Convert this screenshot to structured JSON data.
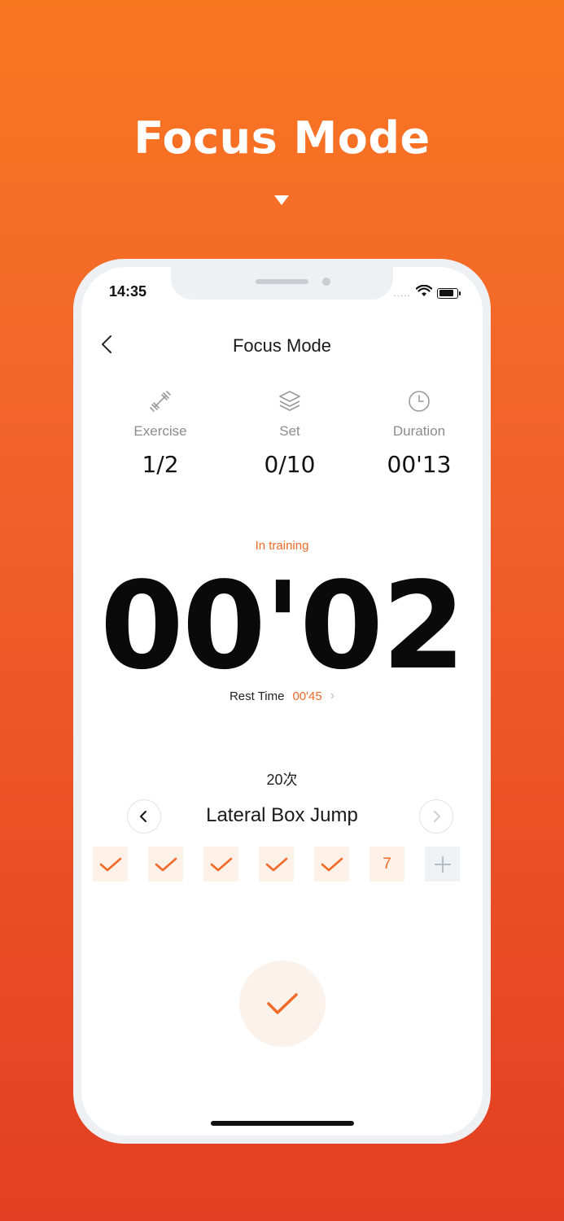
{
  "promo": {
    "title": "Focus Mode"
  },
  "status_bar": {
    "time": "14:35",
    "dots": "....."
  },
  "nav": {
    "title": "Focus Mode"
  },
  "stats": [
    {
      "icon": "dumbbell-icon",
      "label": "Exercise",
      "value": "1/2"
    },
    {
      "icon": "layers-icon",
      "label": "Set",
      "value": "0/10"
    },
    {
      "icon": "clock-icon",
      "label": "Duration",
      "value": "00'13"
    }
  ],
  "timer": {
    "status": "In training",
    "value": "00'02"
  },
  "rest": {
    "label": "Rest Time",
    "value": "00'45",
    "chevron": "›"
  },
  "exercise": {
    "reps": "20次",
    "name": "Lateral Box Jump"
  },
  "sets": {
    "current_label": "7",
    "completed_count": 5
  },
  "colors": {
    "accent": "#F16A28",
    "background_top": "#FA7722",
    "background_bottom": "#E33F22"
  }
}
